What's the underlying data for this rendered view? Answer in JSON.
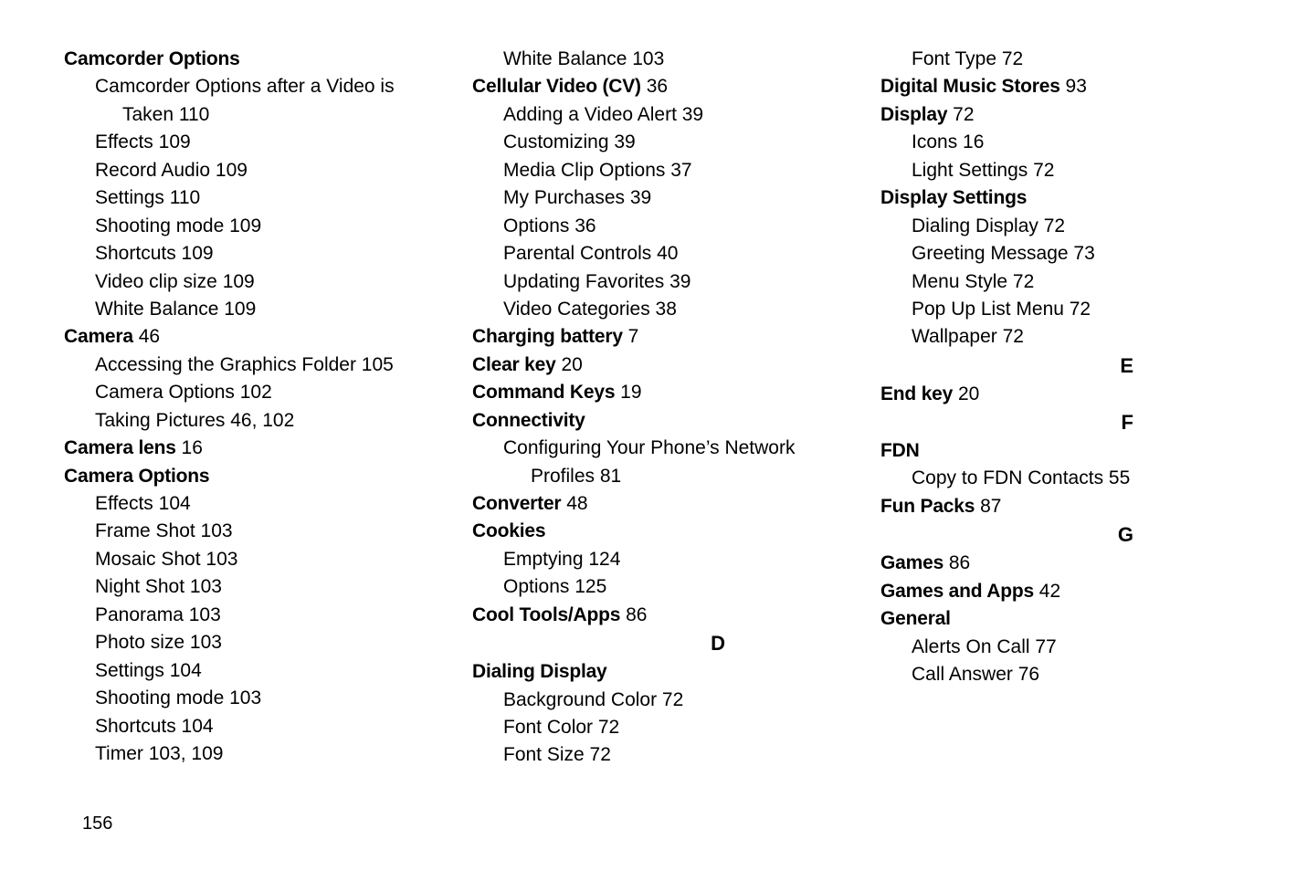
{
  "page_number": "156",
  "entries": [
    {
      "type": "heading",
      "text": "Camcorder Options",
      "page": ""
    },
    {
      "type": "sub",
      "text": "Camcorder Options after a Video is"
    },
    {
      "type": "sub-cont",
      "text": "Taken 110"
    },
    {
      "type": "sub",
      "text": "Effects 109"
    },
    {
      "type": "sub",
      "text": "Record Audio 109"
    },
    {
      "type": "sub",
      "text": "Settings 110"
    },
    {
      "type": "sub",
      "text": "Shooting mode 109"
    },
    {
      "type": "sub",
      "text": "Shortcuts 109"
    },
    {
      "type": "sub",
      "text": "Video clip size 109"
    },
    {
      "type": "sub",
      "text": "White Balance 109"
    },
    {
      "type": "heading",
      "text": "Camera",
      "page": " 46"
    },
    {
      "type": "sub",
      "text": "Accessing the Graphics Folder 105"
    },
    {
      "type": "sub",
      "text": "Camera Options 102"
    },
    {
      "type": "sub",
      "text": "Taking Pictures 46, 102"
    },
    {
      "type": "heading",
      "text": "Camera lens",
      "page": " 16"
    },
    {
      "type": "heading",
      "text": "Camera Options",
      "page": ""
    },
    {
      "type": "sub",
      "text": "Effects 104"
    },
    {
      "type": "sub",
      "text": "Frame Shot 103"
    },
    {
      "type": "sub",
      "text": "Mosaic Shot 103"
    },
    {
      "type": "sub",
      "text": "Night Shot 103"
    },
    {
      "type": "sub",
      "text": "Panorama 103"
    },
    {
      "type": "sub",
      "text": "Photo size 103"
    },
    {
      "type": "sub",
      "text": "Settings 104"
    },
    {
      "type": "sub",
      "text": "Shooting mode 103"
    },
    {
      "type": "sub",
      "text": "Shortcuts 104"
    },
    {
      "type": "sub",
      "text": "Timer 103, 109"
    },
    {
      "type": "sub",
      "text": "White Balance 103"
    },
    {
      "type": "heading",
      "text": "Cellular Video (CV)",
      "page": " 36"
    },
    {
      "type": "sub",
      "text": "Adding a Video Alert 39"
    },
    {
      "type": "sub",
      "text": "Customizing 39"
    },
    {
      "type": "sub",
      "text": "Media Clip Options 37"
    },
    {
      "type": "sub",
      "text": "My Purchases 39"
    },
    {
      "type": "sub",
      "text": "Options 36"
    },
    {
      "type": "sub",
      "text": "Parental Controls 40"
    },
    {
      "type": "sub",
      "text": "Updating Favorites 39"
    },
    {
      "type": "sub",
      "text": "Video Categories 38"
    },
    {
      "type": "heading",
      "text": "Charging battery",
      "page": " 7"
    },
    {
      "type": "heading",
      "text": "Clear key",
      "page": " 20"
    },
    {
      "type": "heading",
      "text": "Command Keys",
      "page": " 19"
    },
    {
      "type": "heading",
      "text": "Connectivity",
      "page": ""
    },
    {
      "type": "sub",
      "text": "Configuring Your Phone’s Network"
    },
    {
      "type": "sub-cont",
      "text": "Profiles 81"
    },
    {
      "type": "heading",
      "text": "Converter",
      "page": " 48"
    },
    {
      "type": "heading",
      "text": "Cookies",
      "page": ""
    },
    {
      "type": "sub",
      "text": "Emptying 124"
    },
    {
      "type": "sub",
      "text": "Options 125"
    },
    {
      "type": "heading",
      "text": "Cool Tools/Apps",
      "page": " 86"
    },
    {
      "type": "letter",
      "text": "D"
    },
    {
      "type": "heading",
      "text": "Dialing Display",
      "page": ""
    },
    {
      "type": "sub",
      "text": "Background Color 72"
    },
    {
      "type": "sub",
      "text": "Font Color 72"
    },
    {
      "type": "sub",
      "text": "Font Size 72"
    },
    {
      "type": "sub",
      "text": "Font Type 72"
    },
    {
      "type": "heading",
      "text": "Digital Music Stores",
      "page": " 93"
    },
    {
      "type": "heading",
      "text": "Display",
      "page": " 72"
    },
    {
      "type": "sub",
      "text": "Icons 16"
    },
    {
      "type": "sub",
      "text": "Light Settings 72"
    },
    {
      "type": "heading",
      "text": "Display Settings",
      "page": ""
    },
    {
      "type": "sub",
      "text": "Dialing Display 72"
    },
    {
      "type": "sub",
      "text": "Greeting Message 73"
    },
    {
      "type": "sub",
      "text": "Menu Style 72"
    },
    {
      "type": "sub",
      "text": "Pop Up List Menu 72"
    },
    {
      "type": "sub",
      "text": "Wallpaper 72"
    },
    {
      "type": "letter",
      "text": "E"
    },
    {
      "type": "heading",
      "text": "End key",
      "page": " 20"
    },
    {
      "type": "letter",
      "text": "F"
    },
    {
      "type": "heading",
      "text": "FDN",
      "page": ""
    },
    {
      "type": "sub",
      "text": "Copy to FDN Contacts 55"
    },
    {
      "type": "heading",
      "text": "Fun Packs",
      "page": " 87"
    },
    {
      "type": "letter",
      "text": "G"
    },
    {
      "type": "heading",
      "text": "Games",
      "page": " 86"
    },
    {
      "type": "heading",
      "text": "Games and Apps",
      "page": " 42"
    },
    {
      "type": "heading",
      "text": "General",
      "page": ""
    },
    {
      "type": "sub",
      "text": "Alerts On Call 77"
    },
    {
      "type": "sub",
      "text": "Call Answer 76"
    }
  ]
}
